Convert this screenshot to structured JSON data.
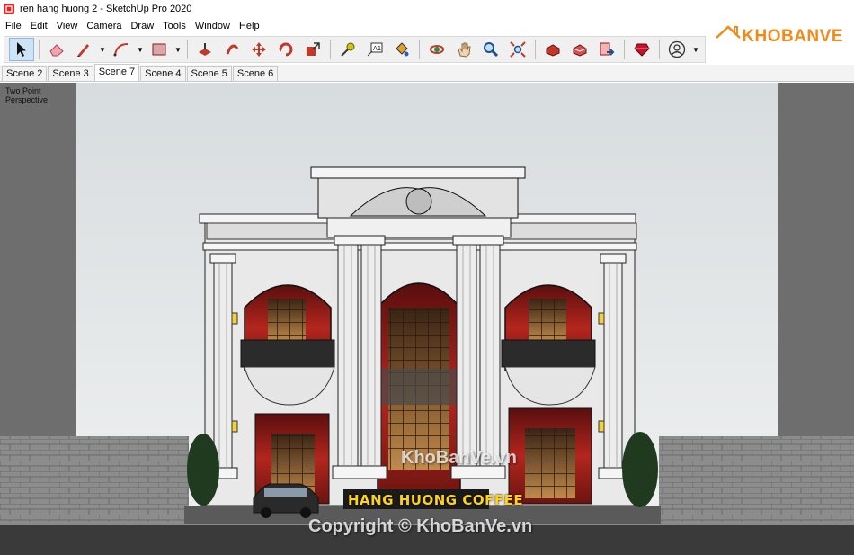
{
  "window": {
    "title": "ren hang huong 2 - SketchUp Pro 2020"
  },
  "menu": [
    "File",
    "Edit",
    "View",
    "Camera",
    "Draw",
    "Tools",
    "Window",
    "Help"
  ],
  "toolbar": {
    "tools": [
      {
        "icon": "select-arrow-icon",
        "glyph": "➤",
        "active": true
      },
      {
        "icon": "eraser-icon",
        "glyph": "⌫"
      },
      {
        "icon": "pencil-line-icon",
        "glyph": "✎",
        "dropdown": true
      },
      {
        "icon": "arc-icon",
        "glyph": "◠",
        "dropdown": true
      },
      {
        "icon": "rectangle-icon",
        "glyph": "▨",
        "dropdown": true
      },
      {
        "icon": "push-pull-icon",
        "glyph": "⬙"
      },
      {
        "icon": "follow-me-icon",
        "glyph": "↻"
      },
      {
        "icon": "move-icon",
        "glyph": "✥"
      },
      {
        "icon": "rotate-icon",
        "glyph": "⟳"
      },
      {
        "icon": "scale-icon",
        "glyph": "⤢"
      },
      {
        "icon": "tape-measure-icon",
        "glyph": "✐"
      },
      {
        "icon": "text-label-icon",
        "glyph": "A1"
      },
      {
        "icon": "paint-bucket-icon",
        "glyph": "🪣"
      },
      {
        "icon": "orbit-icon",
        "glyph": "◍"
      },
      {
        "icon": "pan-hand-icon",
        "glyph": "✋"
      },
      {
        "icon": "zoom-icon",
        "glyph": "🔍"
      },
      {
        "icon": "zoom-extents-icon",
        "glyph": "⤧"
      },
      {
        "icon": "warehouse-icon",
        "glyph": "⬢"
      },
      {
        "icon": "extension-warehouse-icon",
        "glyph": "⬡"
      },
      {
        "icon": "send-to-layout-icon",
        "glyph": "⇨"
      },
      {
        "icon": "ruby-extension-icon",
        "glyph": "◆"
      },
      {
        "icon": "account-icon",
        "glyph": "☺",
        "dropdown": true
      }
    ]
  },
  "logo": {
    "text": "KHOBANVE"
  },
  "scenes": {
    "tabs": [
      "Scene 2",
      "Scene 3",
      "Scene 7",
      "Scene 4",
      "Scene 5",
      "Scene 6"
    ],
    "active": "Scene 7"
  },
  "viewport": {
    "label": "Two Point\nPerspective",
    "label_line1": "Two Point",
    "label_line2": "Perspective",
    "sign": "HANG HUONG COFFEE",
    "watermark_center": "KhoBanVe.vn",
    "watermark_bottom": "Copyright © KhoBanVe.vn"
  },
  "colors": {
    "accent": "#f08a1c",
    "facade_red": "#8b1a1a",
    "sign": "#ffd21a"
  }
}
